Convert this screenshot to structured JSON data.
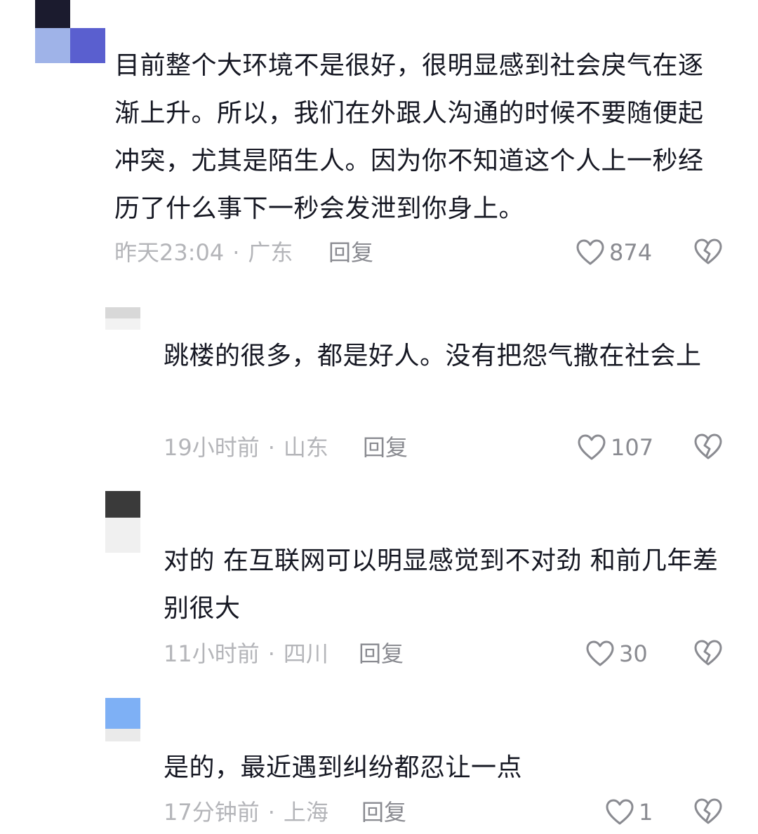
{
  "comments": [
    {
      "text": "目前整个大环境不是很好，很明显感到社会戾气在逐渐上升。所以，我们在外跟人沟通的时候不要随便起冲突，尤其是陌生人。因为你不知道这个人上一秒经历了什么事下一秒会发泄到你身上。",
      "time": "昨天23:04",
      "location": "广东",
      "reply_label": "回复",
      "likes": "874",
      "avatar_colors": [
        "#1b1b2e",
        "#9fb3e8",
        "#5a5fcf"
      ]
    },
    {
      "text": "跳楼的很多，都是好人。没有把怨气撒在社会上",
      "time": "19小时前",
      "location": "山东",
      "reply_label": "回复",
      "likes": "107",
      "avatar_colors": [
        "#d8d8d8",
        "#f2f2f2"
      ]
    },
    {
      "text": "对的 在互联网可以明显感觉到不对劲 和前几年差别很大",
      "time": "11小时前",
      "location": "四川",
      "reply_label": "回复",
      "likes": "30",
      "avatar_colors": [
        "#3a3a3a",
        "#f0f0f0"
      ]
    },
    {
      "text": "是的，最近遇到纠纷都忍让一点",
      "time": "17分钟前",
      "location": "上海",
      "reply_label": "回复",
      "likes": "1",
      "avatar_colors": [
        "#7eb0f5",
        "#eaeaea"
      ]
    }
  ],
  "separator": "·",
  "icons": {
    "like": "heart-outline-icon",
    "dislike": "broken-heart-icon"
  },
  "colors": {
    "text": "#161823",
    "meta": "#b4b5b9",
    "action": "#8a8b91"
  }
}
